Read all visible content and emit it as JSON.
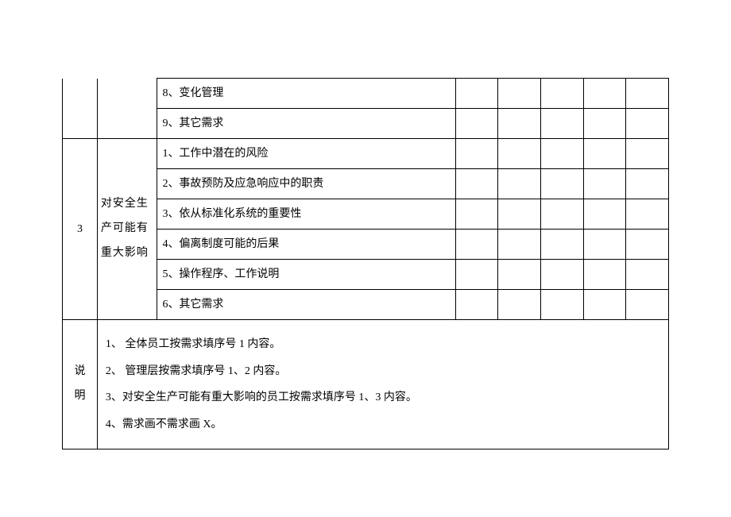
{
  "section_prev": {
    "rows": [
      {
        "item": "8、变化管理"
      },
      {
        "item": "9、其它需求"
      }
    ]
  },
  "section3": {
    "num": "3",
    "category": "对安全生产可能有重大影响",
    "rows": [
      {
        "item": "1、工作中潜在的风险"
      },
      {
        "item": "2、事故预防及应急响应中的职责"
      },
      {
        "item": "3、依从标准化系统的重要性"
      },
      {
        "item": "4、偏离制度可能的后果"
      },
      {
        "item": "5、操作程序、工作说明"
      },
      {
        "item": "6、其它需求"
      }
    ]
  },
  "notes": {
    "label": "说明",
    "lines": [
      "1、 全体员工按需求填序号 1 内容。",
      "2、 管理层按需求填序号 1、2 内容。",
      "3、对安全生产可能有重大影响的员工按需求填序号 1、3 内容。",
      "4、需求画不需求画 X。"
    ]
  }
}
